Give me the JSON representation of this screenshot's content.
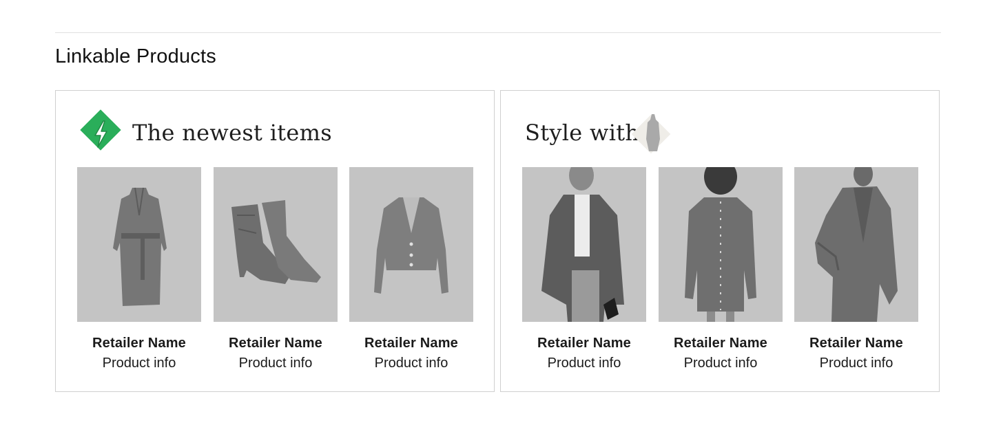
{
  "section": {
    "title": "Linkable Products"
  },
  "cards": [
    {
      "heading": "The newest items",
      "badge_icon": "lightning-bolt-icon",
      "badge_color": "#2aae5a",
      "products": [
        {
          "retailer": "Retailer Name",
          "info": "Product info",
          "image": "trench-coat"
        },
        {
          "retailer": "Retailer Name",
          "info": "Product info",
          "image": "suede-western-boots"
        },
        {
          "retailer": "Retailer Name",
          "info": "Product info",
          "image": "cardigan"
        }
      ]
    },
    {
      "heading": "Style with",
      "badge_icon": "dress-thumbnail",
      "badge_color": "#efede8",
      "products": [
        {
          "retailer": "Retailer Name",
          "info": "Product info",
          "image": "model-tweed-blazer"
        },
        {
          "retailer": "Retailer Name",
          "info": "Product info",
          "image": "model-denim-dress"
        },
        {
          "retailer": "Retailer Name",
          "info": "Product info",
          "image": "model-suit-blazer"
        }
      ]
    }
  ],
  "colors": {
    "image_placeholder": "#c4c4c4",
    "border": "#cfcfcf",
    "divider": "#e0e0e0"
  }
}
